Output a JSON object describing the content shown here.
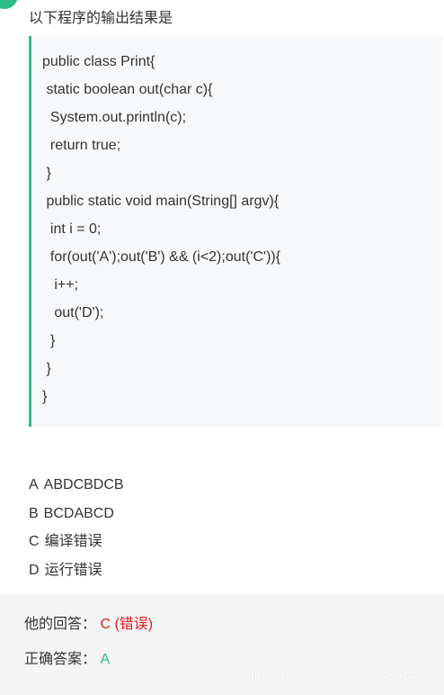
{
  "question": {
    "title": "以下程序的输出结果是"
  },
  "code": {
    "lines": [
      "public class Print{",
      " static boolean out(char c){",
      "  System.out.println(c);",
      "  return true;",
      " }",
      " public static void main(String[] argv){",
      "  int i = 0;",
      "  for(out('A');out('B') && (i<2);out('C')){",
      "   i++;",
      "   out('D');",
      "  }",
      " }",
      "}"
    ]
  },
  "options": [
    {
      "letter": "A",
      "text": "ABDCBDCB"
    },
    {
      "letter": "B",
      "text": "BCDABCD"
    },
    {
      "letter": "C",
      "text": "编译错误"
    },
    {
      "letter": "D",
      "text": "运行错误"
    }
  ],
  "answer": {
    "user_label": "他的回答：",
    "user_value": "C (错误)",
    "correct_label": "正确答案：",
    "correct_value": "A"
  },
  "watermark": "https://blog.csdn.net/qq_45914985",
  "colors": {
    "accent": "#2fbd8a",
    "wrong": "#e02020"
  }
}
